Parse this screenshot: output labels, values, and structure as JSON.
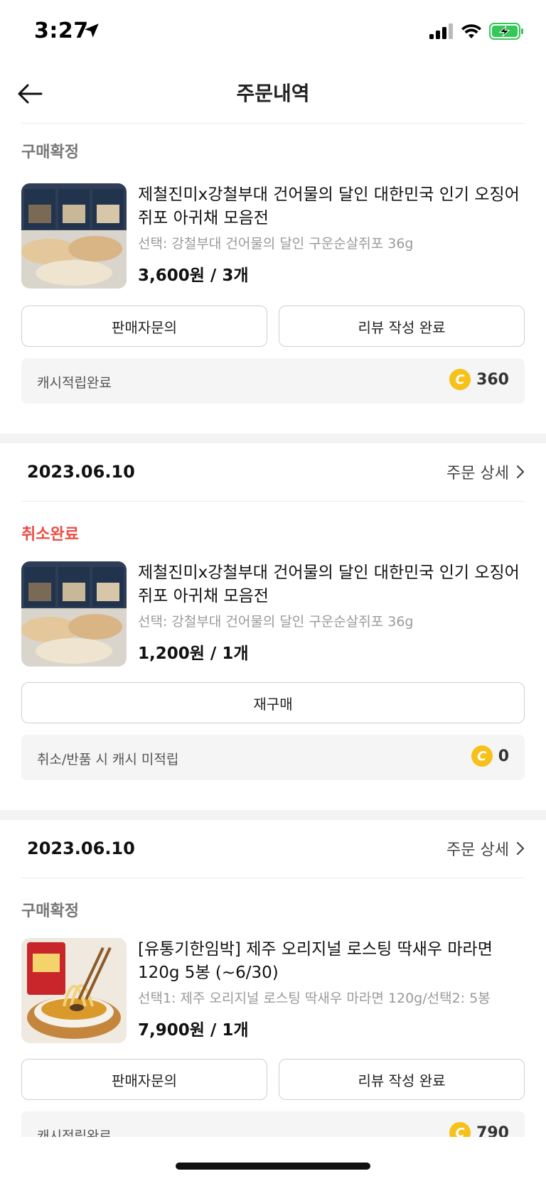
{
  "status_bar": {
    "time": "3:27"
  },
  "header": {
    "title": "주문내역"
  },
  "orders": [
    {
      "status": "구매확정",
      "product": {
        "name": "제철진미x강철부대 건어물의 달인 대한민국 인기 오징어 쥐포 아귀채 모음전",
        "option": "선택: 강철부대 건어물의 달인 구운순살쥐포 36g",
        "price": "3,600원 / 3개"
      },
      "buttons": [
        "판매자문의",
        "리뷰 작성 완료"
      ],
      "cash": {
        "label": "캐시적립완료",
        "amount": "360"
      }
    },
    {
      "date": "2023.06.10",
      "detail_label": "주문 상세",
      "status": "취소완료",
      "product": {
        "name": "제철진미x강철부대 건어물의 달인 대한민국 인기 오징어 쥐포 아귀채 모음전",
        "option": "선택: 강철부대 건어물의 달인 구운순살쥐포 36g",
        "price": "1,200원 / 1개"
      },
      "buttons": [
        "재구매"
      ],
      "cash": {
        "label": "취소/반품 시 캐시 미적립",
        "amount": "0"
      }
    },
    {
      "date": "2023.06.10",
      "detail_label": "주문 상세",
      "status": "구매확정",
      "product": {
        "name": "[유통기한임박] 제주 오리지널 로스팅 딱새우 마라면 120g 5봉 (~6/30)",
        "option": "선택1: 제주 오리지널 로스팅 딱새우 마라면 120g/선택2: 5봉",
        "price": "7,900원 / 1개"
      },
      "buttons": [
        "판매자문의",
        "리뷰 작성 완료"
      ],
      "cash": {
        "label": "캐시적립완료",
        "amount": "790"
      }
    }
  ],
  "colors": {
    "cancel_status": "#ef4b44",
    "coin": "#f6c21a",
    "battery": "#34c759"
  },
  "icons": {
    "back": "arrow-left-icon",
    "chevron": "chevron-right-icon",
    "coin": "cash-coin-icon",
    "location": "location-arrow-icon"
  }
}
